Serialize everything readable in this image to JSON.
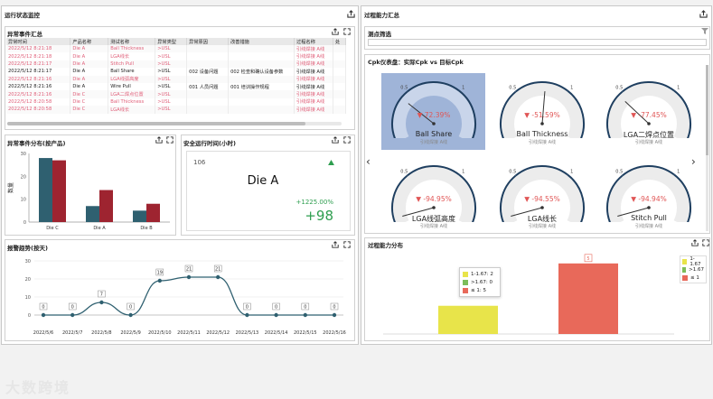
{
  "left_section": {
    "title": "运行状态监控"
  },
  "right_section": {
    "title": "过程能力汇总"
  },
  "events_table": {
    "title": "异常事件汇总",
    "columns": [
      "异常时间",
      "产品名称",
      "测试名称",
      "异常类型",
      "异常原因",
      "改善措施",
      "过程名称",
      "处"
    ],
    "rows": [
      {
        "style": "pink",
        "cells": [
          "2022/5/12 8:21:18",
          "Die A",
          "Ball Thickness",
          ">USL",
          "",
          "",
          "引线焊接 A线",
          ""
        ]
      },
      {
        "style": "pink",
        "cells": [
          "2022/5/12 8:21:18",
          "Die A",
          "LGA线长",
          ">USL",
          "",
          "",
          "引线焊接 A线",
          ""
        ]
      },
      {
        "style": "pink",
        "cells": [
          "2022/5/12 8:21:17",
          "Die A",
          "Stitch Pull",
          ">USL",
          "",
          "",
          "引线焊接 A线",
          ""
        ]
      },
      {
        "style": "black",
        "cells": [
          "2022/5/12 8:21:17",
          "Die A",
          "Ball Share",
          ">USL",
          "002 设备问题",
          "002 检查和确认设备参数",
          "引线焊接 A线",
          ""
        ]
      },
      {
        "style": "pink",
        "cells": [
          "2022/5/12 8:21:16",
          "Die A",
          "LGA线弧高度",
          ">USL",
          "",
          "",
          "引线焊接 A线",
          ""
        ]
      },
      {
        "style": "black",
        "cells": [
          "2022/5/12 8:21:16",
          "Die A",
          "Wire Pull",
          ">USL",
          "001 人员问题",
          "001 培训操作规程",
          "引线焊接 A线",
          ""
        ]
      },
      {
        "style": "pink",
        "cells": [
          "2022/5/12 8:21:16",
          "Die C",
          "LGA二焊点位置",
          ">USL",
          "",
          "",
          "引线焊接 A线",
          ""
        ]
      },
      {
        "style": "pink",
        "cells": [
          "2022/5/12 8:20:58",
          "Die C",
          "Ball Thickness",
          ">USL",
          "",
          "",
          "引线焊接 A线",
          ""
        ]
      },
      {
        "style": "pink",
        "cells": [
          "2022/5/12 8:20:58",
          "Die C",
          "LGA线长",
          ">USL",
          "",
          "",
          "引线焊接 A线",
          ""
        ]
      }
    ]
  },
  "distribution": {
    "title": "异常事件分布(按产品)",
    "chart_data": {
      "type": "bar",
      "categories": [
        "Die C",
        "Die A",
        "Die B"
      ],
      "series": [
        {
          "name": "",
          "values": [
            28,
            7,
            5
          ],
          "color": "#2f6070"
        },
        {
          "name": "",
          "values": [
            27,
            14,
            8
          ],
          "color": "#9e2430"
        }
      ],
      "ylabel": "数量",
      "ylim": [
        0,
        30
      ],
      "yticks": [
        0,
        10,
        20,
        30
      ]
    }
  },
  "safe_time": {
    "title": "安全运行时间(小时)",
    "count": "106",
    "product": "Die A",
    "percent": "+1225.00%",
    "delta": "+98"
  },
  "trend": {
    "title": "报警趋势(按天)",
    "chart_data": {
      "type": "line",
      "categories": [
        "2022/5/6",
        "2022/5/7",
        "2022/5/8",
        "2022/5/9",
        "2022/5/10",
        "2022/5/11",
        "2022/5/12",
        "2022/5/13",
        "2022/5/14",
        "2022/5/15",
        "2022/5/16"
      ],
      "values": [
        0,
        0,
        7,
        0,
        19,
        21,
        21,
        0,
        0,
        0,
        0
      ],
      "ylim": [
        0,
        30
      ],
      "yticks": [
        0,
        10,
        20,
        30
      ]
    }
  },
  "filter": {
    "title": "测点筛选"
  },
  "cpk": {
    "title": "Cpk仪表盘：实际Cpk vs 目标Cpk",
    "gauges": [
      {
        "name": "Ball Share",
        "value": "72.39%",
        "min": "0",
        "mid_low": "0.5",
        "mid_high": "1",
        "max": "1.5",
        "sub": "引线焊接 A线",
        "fraction": 0.28,
        "selected": true
      },
      {
        "name": "Ball Thickness",
        "value": "-51.59%",
        "min": "0",
        "mid_low": "0.5",
        "mid_high": "1",
        "max": "1.5",
        "sub": "引线焊接 A线",
        "fraction": 0.52,
        "selected": false
      },
      {
        "name": "LGA二焊点位置",
        "value": "-77.45%",
        "min": "0",
        "mid_low": "0.5",
        "mid_high": "1",
        "max": "1.5",
        "sub": "引线焊接 A线",
        "fraction": 0.3,
        "selected": false
      },
      {
        "name": "LGA线弧高度",
        "value": "-94.95%",
        "min": "0",
        "mid_low": "0.5",
        "mid_high": "1",
        "max": "1.5",
        "sub": "引线焊接 A线",
        "fraction": 0.05,
        "selected": false
      },
      {
        "name": "LGA线长",
        "value": "-94.55%",
        "min": "0",
        "mid_low": "0.5",
        "mid_high": "1",
        "max": "1.5",
        "sub": "引线焊接 A线",
        "fraction": 0.05,
        "selected": false
      },
      {
        "name": "Stitch Pull",
        "value": "-94.94%",
        "min": "0",
        "mid_low": "0.5",
        "mid_high": "1",
        "max": "1.5",
        "sub": "引线焊接 A线",
        "fraction": 0.05,
        "selected": false
      }
    ]
  },
  "capability": {
    "title": "过程能力分布",
    "tooltip": [
      {
        "label": "1-1.67: 2",
        "color": "#e8e44a"
      },
      {
        "label": ">1.67: 0",
        "color": "#7dbd5a"
      },
      {
        "label": "≤ 1: 5",
        "color": "#e8695a"
      }
    ],
    "chart_data": {
      "type": "bar",
      "categories": [
        "1-1.67",
        "≤ 1"
      ],
      "values": [
        2,
        5
      ],
      "colors": [
        "#e8e44a",
        "#e8695a"
      ],
      "bar_label": "5"
    },
    "legend": [
      {
        "label": "1-1.67",
        "color": "#e8e44a"
      },
      {
        "label": ">1.67",
        "color": "#7dbd5a"
      },
      {
        "label": "≤ 1",
        "color": "#e8695a"
      }
    ]
  },
  "watermark": "大数跨境"
}
